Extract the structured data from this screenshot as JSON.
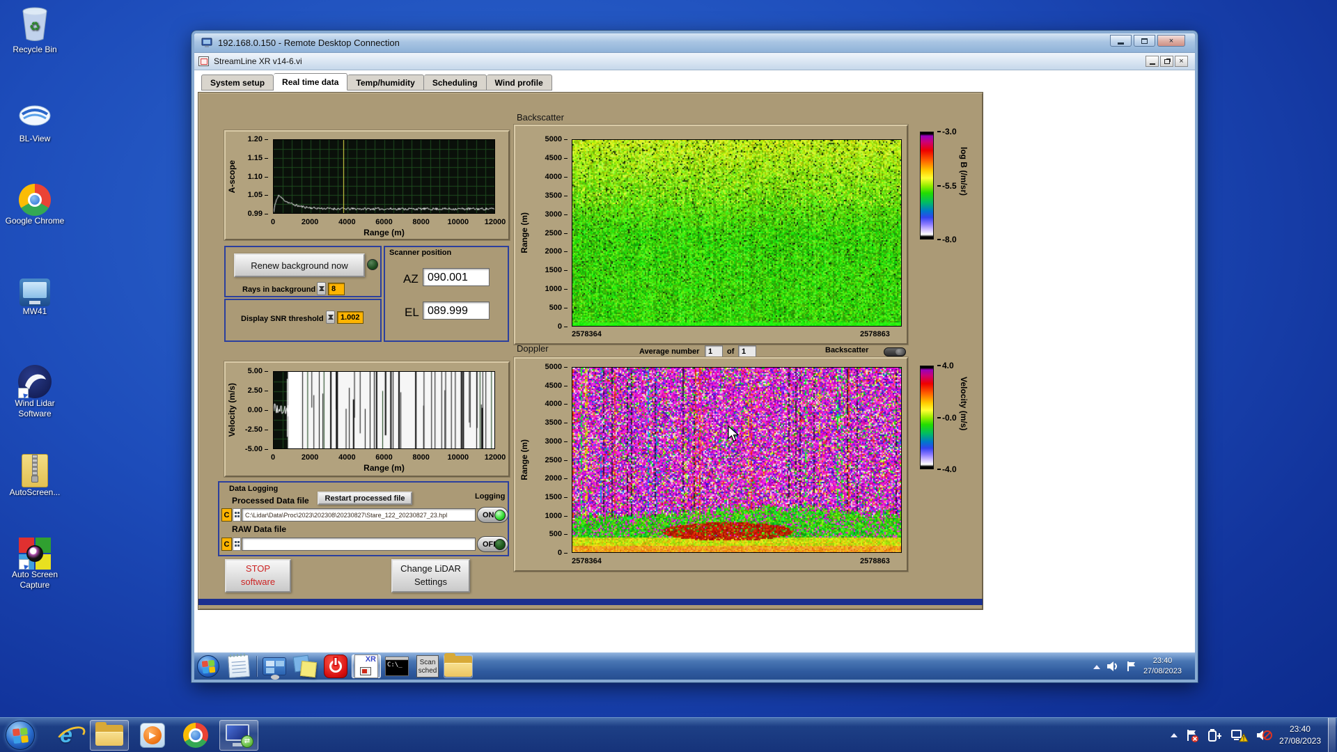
{
  "glyphs": {
    "close_x": "×",
    "recycle": "♻",
    "ie_e": "e",
    "play": "▶",
    "sync": "⇄"
  },
  "desktop": {
    "icons": [
      {
        "label": "Recycle Bin"
      },
      {
        "label": "BL-View"
      },
      {
        "label": "Google Chrome"
      },
      {
        "label": "MW41"
      },
      {
        "label": "Wind Lidar Software"
      },
      {
        "label": "AutoScreen..."
      },
      {
        "label": "Auto Screen Capture"
      }
    ]
  },
  "rdp": {
    "title": "192.168.0.150 - Remote Desktop Connection"
  },
  "app": {
    "title": "StreamLine XR v14-6.vi",
    "tabs": [
      "System setup",
      "Real time data",
      "Temp/humidity",
      "Scheduling",
      "Wind profile"
    ],
    "active_tab": "Real time data"
  },
  "controls": {
    "renew_button": "Renew background now",
    "rays_label": "Rays in background",
    "rays_value": "8",
    "snr_label": "Display SNR threshold",
    "snr_value": "1.002",
    "scanner": {
      "title": "Scanner position",
      "az_label": "AZ",
      "az_value": "090.001",
      "el_label": "EL",
      "el_value": "089.999"
    },
    "doppler_bar": {
      "average_label": "Average number",
      "average_value": "1",
      "of_label": "of",
      "of_value": "1",
      "toggle_label": "Backscatter"
    },
    "logging": {
      "title": "Data Logging",
      "processed_label": "Processed Data file",
      "restart_button": "Restart processed file",
      "logging_label": "Logging",
      "drive_letter": "C",
      "processed_path": "C:\\Lidar\\Data\\Proc\\2023\\202308\\20230827\\Stare_122_20230827_23.hpl",
      "on_label": "ON",
      "raw_label": "RAW Data file",
      "raw_path": "",
      "off_label": "OFF"
    },
    "stop_line1": "STOP",
    "stop_line2": "software",
    "change_line1": "Change LiDAR",
    "change_line2": "Settings"
  },
  "chart_data": [
    {
      "id": "ascope",
      "type": "line",
      "ylabel": "A-scope",
      "xlabel": "Range (m)",
      "yticks": [
        "1.20",
        "1.15",
        "1.10",
        "1.05",
        "0.99"
      ],
      "xticks": [
        "0",
        "2000",
        "4000",
        "6000",
        "8000",
        "10000",
        "12000"
      ],
      "ylim": [
        0.99,
        1.2
      ],
      "xlim": [
        0,
        12000
      ],
      "cursor_x": 3800,
      "grid": true,
      "series": [
        {
          "name": "a-scope-trace",
          "description": "white noise trace, peak ~1.04 near 250 m decaying to ~1.002 baseline out to 12000 m"
        }
      ]
    },
    {
      "id": "velocity",
      "type": "line",
      "ylabel": "Velocity (m/s)",
      "xlabel": "Range (m)",
      "yticks": [
        "5.00",
        "2.50",
        "0.00",
        "-2.50",
        "-5.00"
      ],
      "xticks": [
        "0",
        "2000",
        "4000",
        "6000",
        "8000",
        "10000",
        "12000"
      ],
      "ylim": [
        -5,
        5
      ],
      "xlim": [
        0,
        12000
      ],
      "noise_onset_m": 1300,
      "grid": true,
      "series": [
        {
          "name": "velocity-trace",
          "description": "coherent ~0 m/s trace below ~1300 m; saturated noise (white band with black dropout lines) beyond"
        }
      ]
    },
    {
      "id": "backscatter",
      "type": "heatmap",
      "title": "Backscatter",
      "ylabel": "Range (m)",
      "yticks": [
        "5000",
        "4500",
        "4000",
        "3500",
        "3000",
        "2500",
        "2000",
        "1500",
        "1000",
        "500",
        "0"
      ],
      "ylim": [
        0,
        5000
      ],
      "x_start_label": "2578364",
      "x_end_label": "2578863",
      "colorbar": {
        "label": "log B (/m/sr)",
        "ticks": [
          "-3.0",
          "-5.5",
          "-8.0"
        ],
        "range": [
          -3,
          -8
        ]
      },
      "description": "speckled green field near -5.5 log B, yellower speckle aloft, smooth bright green near the surface"
    },
    {
      "id": "doppler",
      "type": "heatmap",
      "title": "Doppler",
      "ylabel": "Range (m)",
      "yticks": [
        "5000",
        "4500",
        "4000",
        "3500",
        "3000",
        "2500",
        "2000",
        "1500",
        "1000",
        "500",
        "0"
      ],
      "ylim": [
        0,
        5000
      ],
      "x_start_label": "2578364",
      "x_end_label": "2578863",
      "colorbar": {
        "label": "Velocity (m/s)",
        "ticks": [
          "4.0",
          "-0.0",
          "-4.0"
        ],
        "range": [
          4,
          -4
        ]
      },
      "description": "magenta/purple random noise aloft with rainbow streaks; coherent green/yellow aerosol returns below ~1000 m with red patch near 500-800 m"
    }
  ],
  "session_taskbar": {
    "xr_label": "XR",
    "cmd_label": "C:\\_",
    "scan_line1": "Scan",
    "scan_line2": "sched",
    "clock_time": "23:40",
    "clock_date": "27/08/2023"
  },
  "host_taskbar": {
    "clock_time": "23:40",
    "clock_date": "27/08/2023"
  }
}
